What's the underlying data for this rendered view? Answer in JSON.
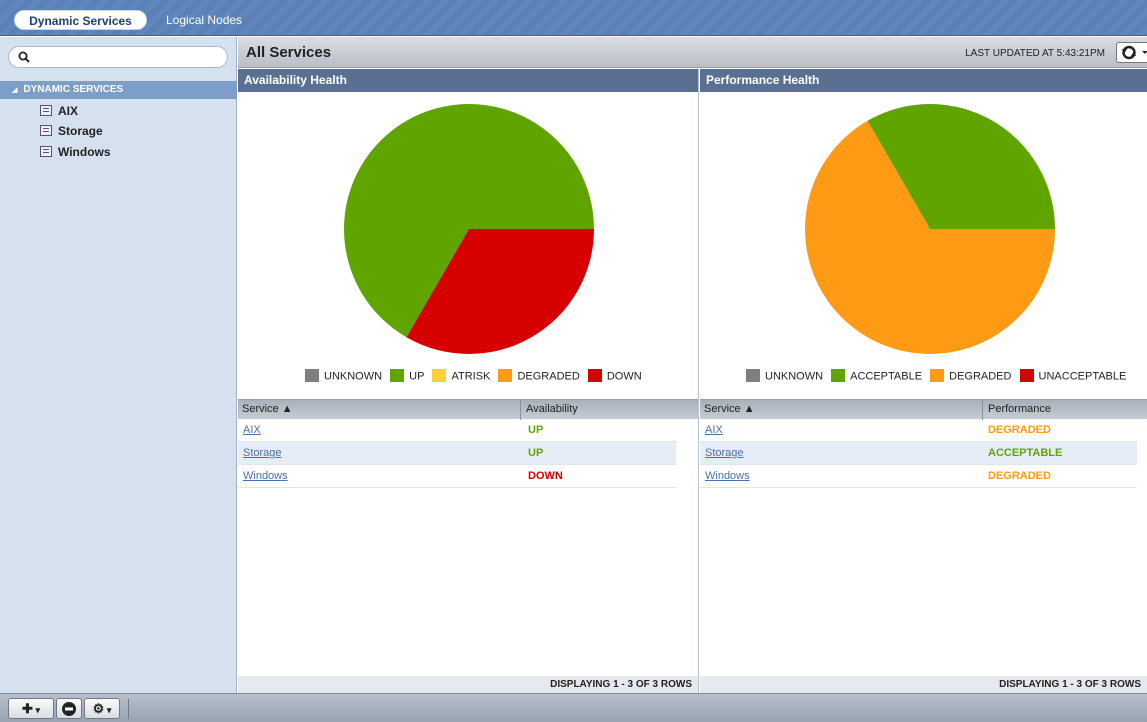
{
  "tabs": [
    {
      "label": "Dynamic Services",
      "active": true
    },
    {
      "label": "Logical Nodes",
      "active": false
    }
  ],
  "sidebar": {
    "search_placeholder": "",
    "root_label": "DYNAMIC SERVICES",
    "items": [
      {
        "label": "AIX"
      },
      {
        "label": "Storage"
      },
      {
        "label": "Windows"
      }
    ]
  },
  "header": {
    "title": "All Services",
    "last_updated": "LAST UPDATED AT 5:43:21PM"
  },
  "colors": {
    "unknown": "#7f7f7f",
    "up": "#60a400",
    "atrisk": "#ffd033",
    "degraded": "#ff9a14",
    "down": "#d60000"
  },
  "availability": {
    "title": "Availability Health",
    "legend": [
      "UNKNOWN",
      "UP",
      "ATRISK",
      "DEGRADED",
      "DOWN"
    ],
    "col_service": "Service ▲",
    "col_status": "Availability",
    "rows": [
      {
        "service": "AIX",
        "status": "UP"
      },
      {
        "service": "Storage",
        "status": "UP"
      },
      {
        "service": "Windows",
        "status": "DOWN"
      }
    ],
    "footer": "DISPLAYING 1 - 3 OF 3 ROWS"
  },
  "performance": {
    "title": "Performance Health",
    "legend": [
      "UNKNOWN",
      "ACCEPTABLE",
      "DEGRADED",
      "UNACCEPTABLE"
    ],
    "col_service": "Service ▲",
    "col_status": "Performance",
    "rows": [
      {
        "service": "AIX",
        "status": "DEGRADED"
      },
      {
        "service": "Storage",
        "status": "ACCEPTABLE"
      },
      {
        "service": "Windows",
        "status": "DEGRADED"
      }
    ],
    "footer": "DISPLAYING 1 - 3 OF 3 ROWS"
  },
  "chart_data": [
    {
      "type": "pie",
      "title": "Availability Health",
      "categories": [
        "UNKNOWN",
        "UP",
        "ATRISK",
        "DEGRADED",
        "DOWN"
      ],
      "values": [
        0,
        2,
        0,
        0,
        1
      ]
    },
    {
      "type": "pie",
      "title": "Performance Health",
      "categories": [
        "UNKNOWN",
        "ACCEPTABLE",
        "DEGRADED",
        "UNACCEPTABLE"
      ],
      "values": [
        0,
        1,
        2,
        0
      ]
    }
  ]
}
